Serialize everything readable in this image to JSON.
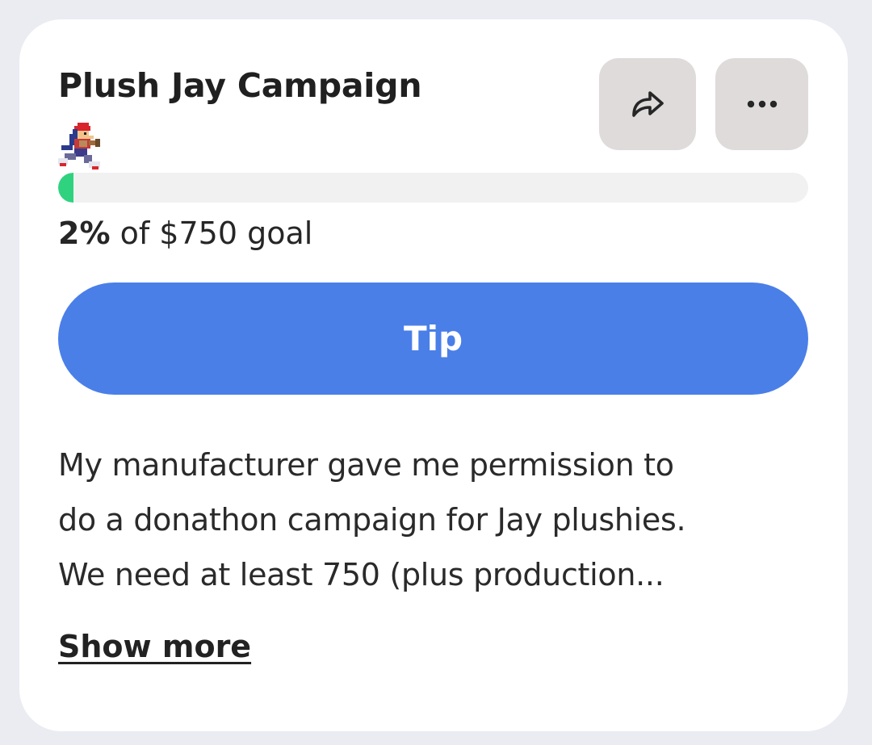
{
  "campaign": {
    "title": "Plush Jay Campaign",
    "progress_percent": 2,
    "goal_pct_label": "2%",
    "goal_rest_label": " of $750 goal",
    "tip_label": "Tip",
    "description_lines": [
      "My manufacturer gave me permission to",
      "do a donathon campaign for Jay plushies.",
      "We need at least 750 (plus production..."
    ],
    "show_more_label": "Show more"
  },
  "icons": {
    "share": "share-icon",
    "more": "more-horizontal-icon",
    "sprite": "jay-sprite-icon"
  },
  "colors": {
    "accent": "#4a7fe8",
    "progress": "#2fd37f",
    "icon_button_bg": "#dfdbdb"
  }
}
